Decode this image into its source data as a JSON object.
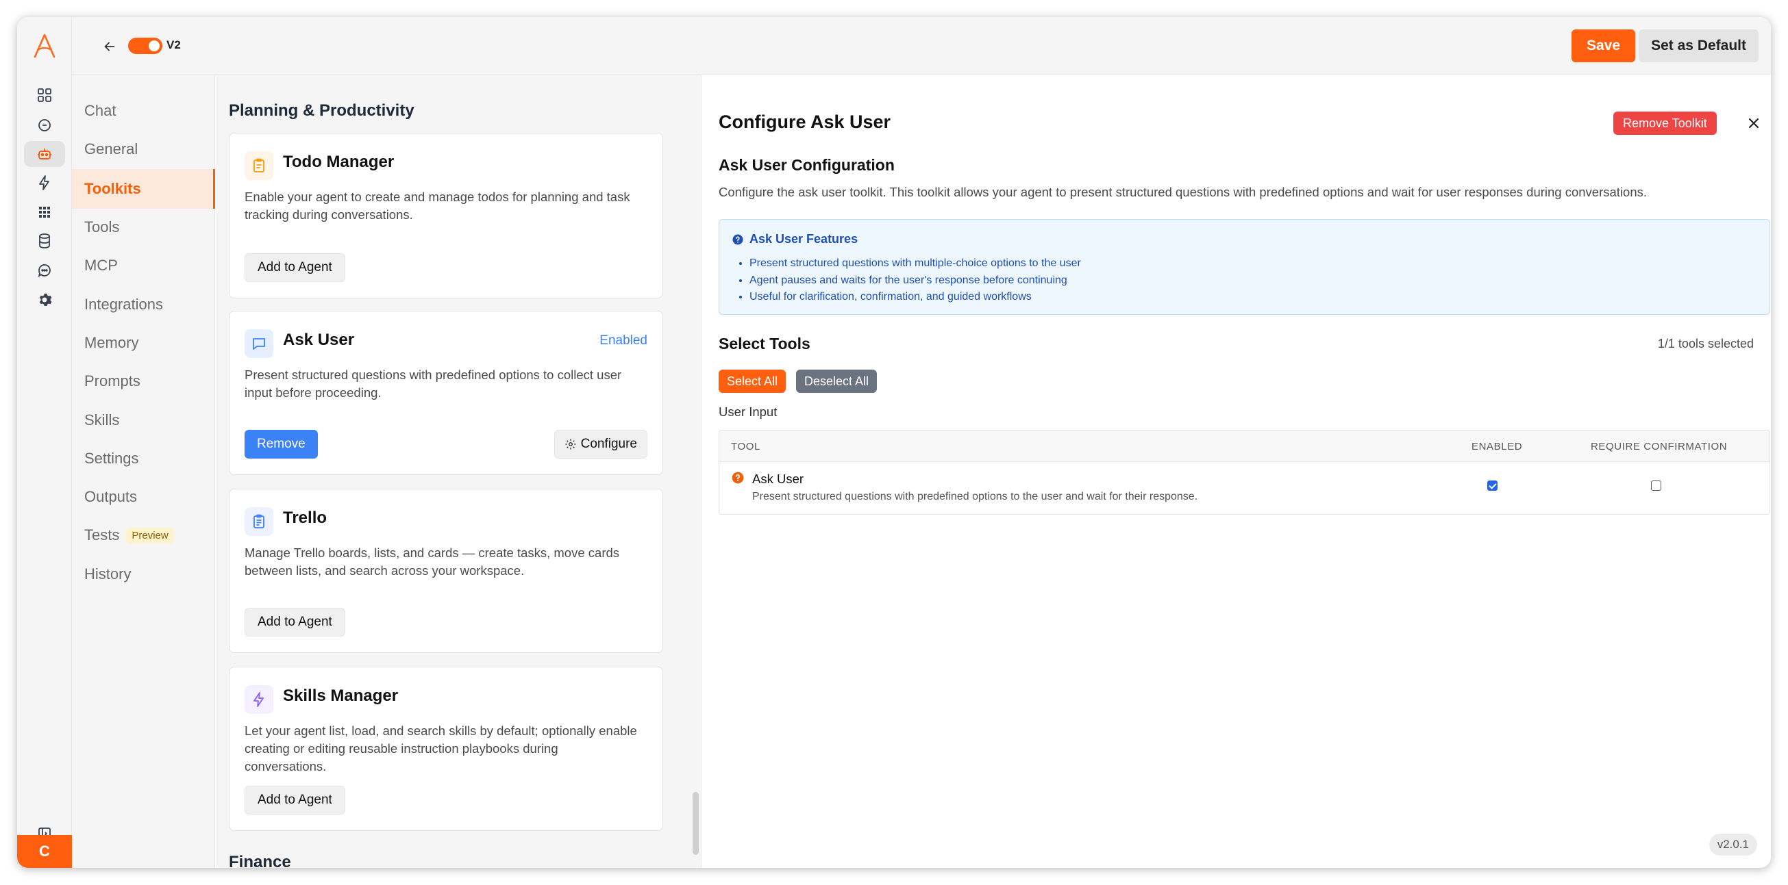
{
  "app": {
    "version_toggle_label": "V2",
    "version_badge": "v2.0.1",
    "user_initial": "C"
  },
  "header": {
    "save_label": "Save",
    "set_default_label": "Set as Default"
  },
  "rail_icons": [
    "dashboard-icon",
    "chat-bubble-icon",
    "robot-icon",
    "lightning-icon",
    "apps-grid-icon",
    "database-icon",
    "message-icon",
    "gear-icon"
  ],
  "nav": {
    "items": [
      {
        "label": "Chat"
      },
      {
        "label": "General"
      },
      {
        "label": "Toolkits",
        "active": true
      },
      {
        "label": "Tools"
      },
      {
        "label": "MCP"
      },
      {
        "label": "Integrations"
      },
      {
        "label": "Memory"
      },
      {
        "label": "Prompts"
      },
      {
        "label": "Skills"
      },
      {
        "label": "Settings"
      },
      {
        "label": "Outputs"
      },
      {
        "label": "Tests",
        "badge": "Preview"
      },
      {
        "label": "History"
      }
    ]
  },
  "middle": {
    "section_title": "Planning & Productivity",
    "next_section_title": "Finance",
    "cards": [
      {
        "title": "Todo Manager",
        "description": "Enable your agent to create and manage todos for planning and task tracking during conversations.",
        "action": "Add to Agent",
        "icon": "clipboard-icon"
      },
      {
        "title": "Ask User",
        "status": "Enabled",
        "description": "Present structured questions with predefined options to collect user input before proceeding.",
        "action": "Remove",
        "configure": "Configure",
        "icon": "chat-square-icon"
      },
      {
        "title": "Trello",
        "description": "Manage Trello boards, lists, and cards — create tasks, move cards between lists, and search across your workspace.",
        "action": "Add to Agent",
        "icon": "clipboard-list-icon"
      },
      {
        "title": "Skills Manager",
        "description": "Let your agent list, load, and search skills by default; optionally enable creating or editing reusable instruction playbooks during conversations.",
        "action": "Add to Agent",
        "icon": "lightning-icon"
      }
    ]
  },
  "panel": {
    "title": "Configure Ask User",
    "remove_toolkit": "Remove Toolkit",
    "config_title": "Ask User Configuration",
    "config_desc": "Configure the ask user toolkit. This toolkit allows your agent to present structured questions with predefined options and wait for user responses during conversations.",
    "features_title": "Ask User Features",
    "features": [
      "Present structured questions with multiple-choice options to the user",
      "Agent pauses and waits for the user's response before continuing",
      "Useful for clarification, confirmation, and guided workflows"
    ],
    "select_tools_title": "Select Tools",
    "tools_selected": "1/1 tools selected",
    "select_all": "Select All",
    "deselect_all": "Deselect All",
    "group_label": "User Input",
    "columns": {
      "tool": "TOOL",
      "enabled": "ENABLED",
      "require_confirmation": "REQUIRE CONFIRMATION"
    },
    "tools": [
      {
        "name": "Ask User",
        "description": "Present structured questions with predefined options to the user and wait for their response.",
        "enabled": true,
        "require_confirmation": false
      }
    ]
  },
  "colors": {
    "accent": "#ff5f0f",
    "danger": "#ef4444",
    "info_bg": "#eef6fe",
    "info_text": "#1e4fb5",
    "link_blue": "#3b82f6"
  }
}
